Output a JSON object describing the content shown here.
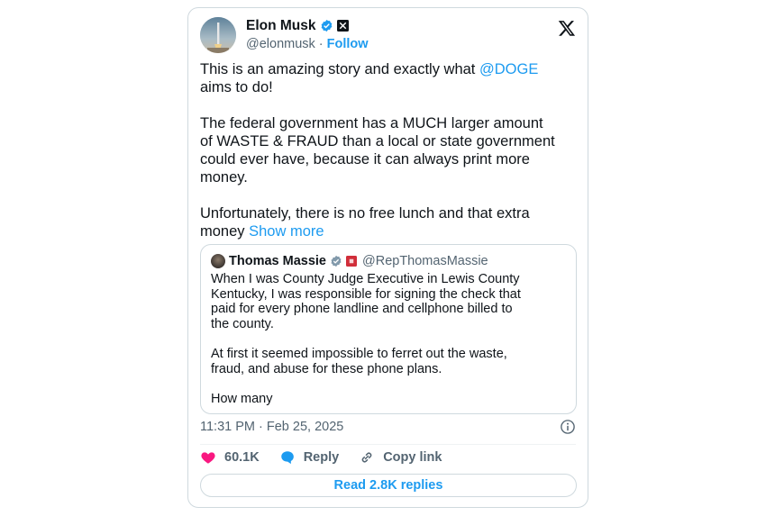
{
  "author": {
    "name": "Elon Musk",
    "handle": "@elonmusk",
    "separator": "·",
    "follow_label": "Follow",
    "verified_icon": "verified-badge-icon",
    "affiliation_icon": "x-affiliate-icon"
  },
  "brand": {
    "logo": "x-logo-icon"
  },
  "tweet": {
    "p1_before": "This is an amazing story and exactly what ",
    "p1_mention": "@DOGE",
    "p1_after": "\naims to do!",
    "p2": "The federal government has a MUCH larger amount\nof WASTE & FRAUD than a local or state government\ncould ever have, because it can always print more\nmoney.",
    "p3": "Unfortunately, there is no free lunch and that extra\nmoney ",
    "show_more": "Show more"
  },
  "quote": {
    "name": "Thomas Massie",
    "handle": "@RepThomasMassie",
    "text": "When I was County Judge Executive in Lewis County\nKentucky, I was responsible for signing the check that\npaid for every phone landline and cellphone billed to\nthe county.\n\nAt first it seemed impossible to ferret out the waste,\nfraud, and abuse for these phone plans.\n\nHow many"
  },
  "meta": {
    "timestamp": "11:31 PM · Feb 25, 2025"
  },
  "actions": {
    "likes": "60.1K",
    "reply_label": "Reply",
    "copy_label": "Copy link"
  },
  "read_replies": "Read 2.8K replies",
  "colors": {
    "accent": "#1d9bf0",
    "like": "#f91880",
    "text": "#0f1419",
    "muted": "#536471",
    "border": "#cfd9de"
  }
}
